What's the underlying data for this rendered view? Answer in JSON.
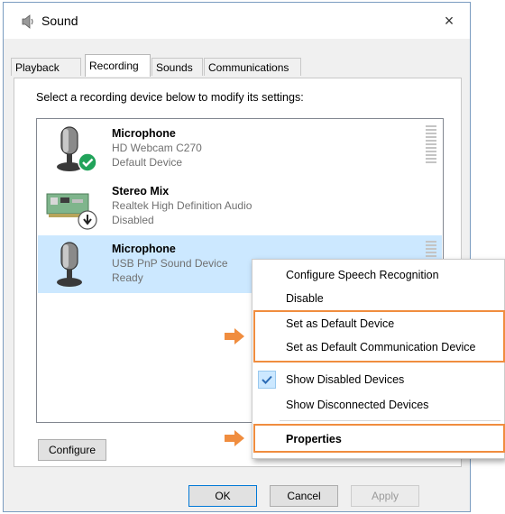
{
  "window": {
    "title": "Sound",
    "close_glyph": "×"
  },
  "tabs": [
    {
      "label": "Playback",
      "active": false
    },
    {
      "label": "Recording",
      "active": true
    },
    {
      "label": "Sounds",
      "active": false
    },
    {
      "label": "Communications",
      "active": false
    }
  ],
  "instruction": "Select a recording device below to modify its settings:",
  "devices": [
    {
      "name": "Microphone",
      "description": "HD Webcam C270",
      "status": "Default Device",
      "icon": "webcam-microphone-icon",
      "badge": "default-check-icon",
      "selected": false
    },
    {
      "name": "Stereo Mix",
      "description": "Realtek High Definition Audio",
      "status": "Disabled",
      "icon": "sound-card-icon",
      "badge": "disabled-arrow-icon",
      "selected": false
    },
    {
      "name": "Microphone",
      "description": "USB PnP Sound Device",
      "status": "Ready",
      "icon": "microphone-icon",
      "badge": "",
      "selected": true
    }
  ],
  "buttons": {
    "configure": "Configure",
    "ok": "OK",
    "cancel": "Cancel",
    "apply": "Apply"
  },
  "context_menu": {
    "items": [
      {
        "label": "Configure Speech Recognition",
        "bold": false,
        "checked": false
      },
      {
        "label": "Disable",
        "bold": false,
        "checked": false
      },
      {
        "label": "Set as Default Device",
        "bold": false,
        "checked": false
      },
      {
        "label": "Set as Default Communication Device",
        "bold": false,
        "checked": false
      },
      {
        "label": "Show Disabled Devices",
        "bold": false,
        "checked": true
      },
      {
        "label": "Show Disconnected Devices",
        "bold": false,
        "checked": false
      },
      {
        "label": "Properties",
        "bold": true,
        "checked": false
      }
    ]
  },
  "colors": {
    "highlight_orange": "#f08d3f",
    "selection_blue": "#cce8ff",
    "check_green": "#21a35a",
    "accent_blue": "#0078d7"
  }
}
